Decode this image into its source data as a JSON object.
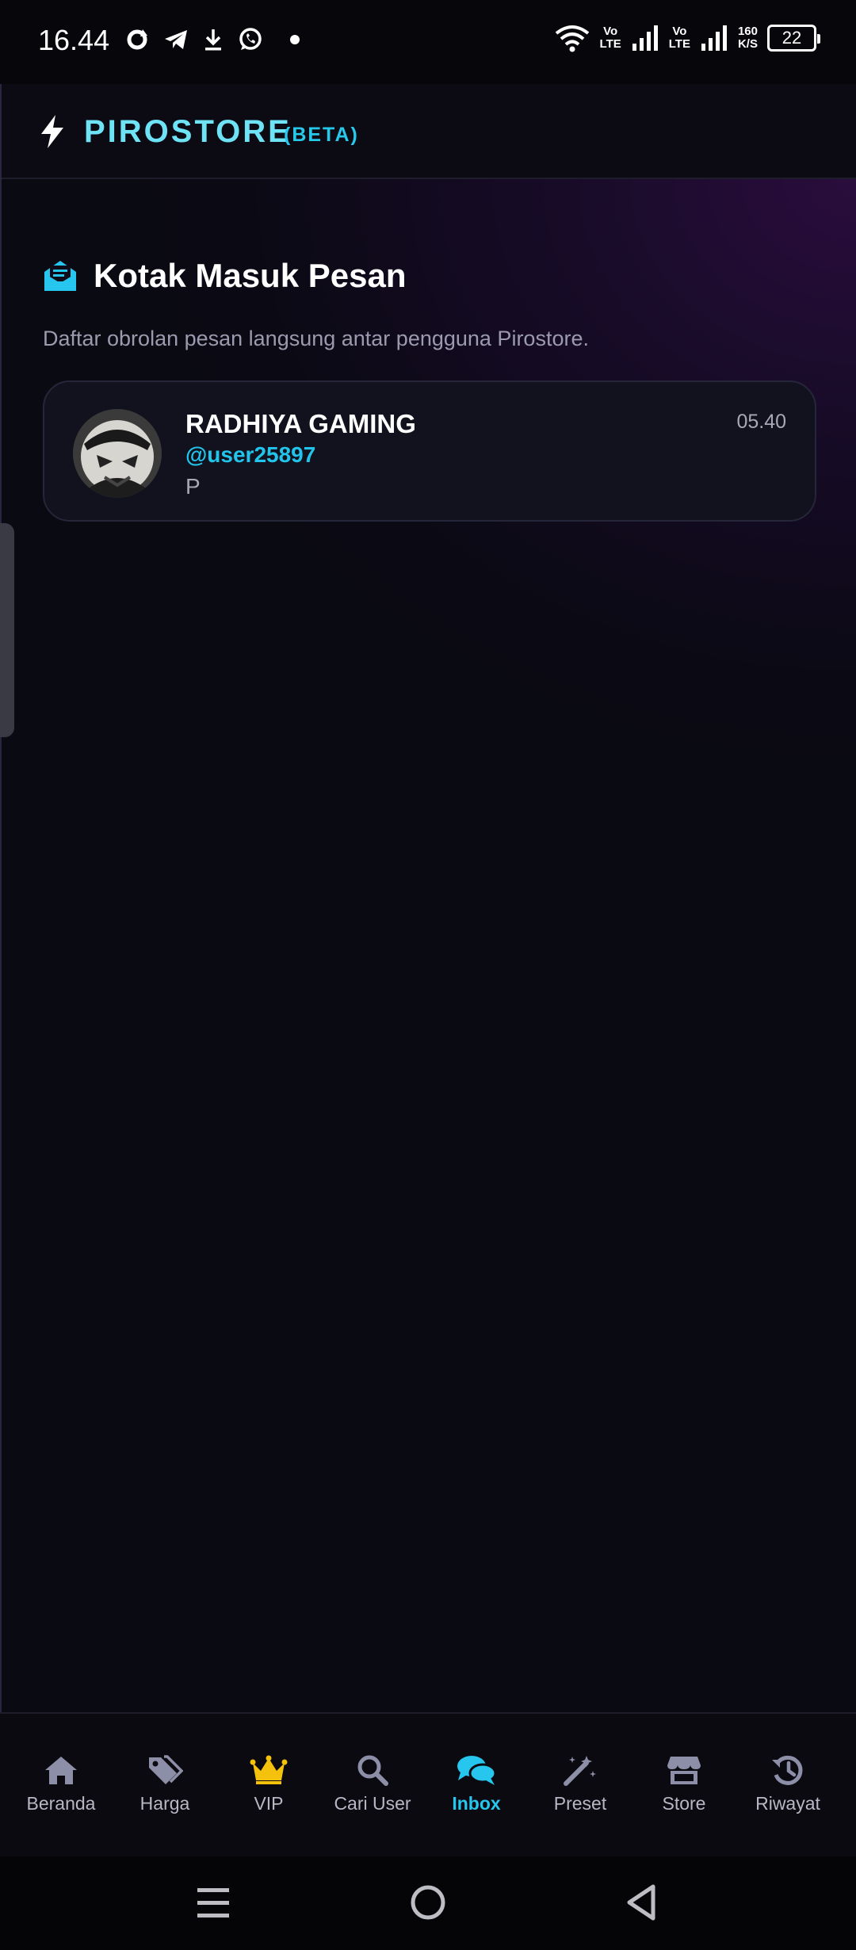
{
  "status_bar": {
    "time": "16.44",
    "volte1": "Vo\nLTE",
    "volte2": "Vo\nLTE",
    "net_speed_value": "160",
    "net_speed_unit": "K/S",
    "battery": "22"
  },
  "header": {
    "brand": "PIROSTORE",
    "beta": "(BETA)",
    "accent_color": "#6ee3f5"
  },
  "inbox": {
    "title": "Kotak Masuk Pesan",
    "subtitle": "Daftar obrolan pesan langsung antar pengguna Pirostore.",
    "conversations": [
      {
        "name": "RADHIYA GAMING",
        "username": "@user25897",
        "last_message": "P",
        "time": "05.40"
      }
    ]
  },
  "bottom_nav": {
    "items": [
      {
        "label": "Beranda",
        "icon": "home-icon"
      },
      {
        "label": "Harga",
        "icon": "tags-icon"
      },
      {
        "label": "VIP",
        "icon": "crown-icon"
      },
      {
        "label": "Cari User",
        "icon": "search-icon"
      },
      {
        "label": "Inbox",
        "icon": "chat-icon",
        "active": true
      },
      {
        "label": "Preset",
        "icon": "magic-wand-icon"
      },
      {
        "label": "Store",
        "icon": "store-icon"
      },
      {
        "label": "Riwayat",
        "icon": "history-icon"
      }
    ],
    "active_color": "#27c6ee"
  }
}
